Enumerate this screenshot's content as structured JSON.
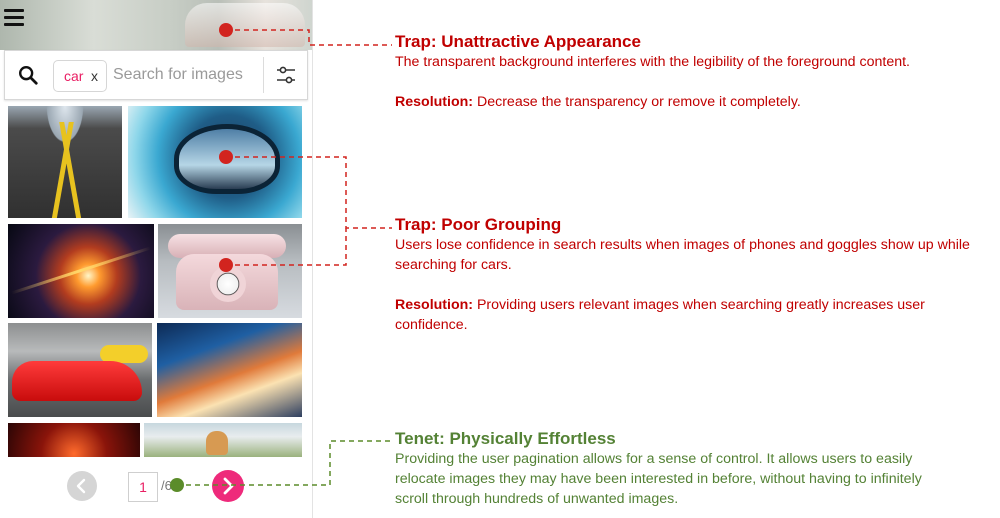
{
  "search": {
    "chip_label": "car",
    "chip_remove": "x",
    "placeholder": "Search for images"
  },
  "images": [
    {
      "subject": "road with yellow lines"
    },
    {
      "subject": "ski goggles reflection"
    },
    {
      "subject": "light streaks"
    },
    {
      "subject": "pink rotary telephone"
    },
    {
      "subject": "red Ferrari"
    },
    {
      "subject": "traffic light trails"
    },
    {
      "subject": "red light streaks"
    },
    {
      "subject": "dog on street"
    }
  ],
  "pagination": {
    "current_page": "1",
    "separator": "/6"
  },
  "colors": {
    "trap": "#c00000",
    "tenet": "#548235",
    "accent": "#ee2a7b",
    "marker_red": "#d2241f",
    "marker_green": "#5b8c2a"
  },
  "annotations": {
    "trap1": {
      "title": "Trap: Unattractive Appearance",
      "body": "The transparent background interferes with the legibility of the foreground content.",
      "resolution_label": "Resolution:",
      "resolution_text": " Decrease the transparency or remove it completely."
    },
    "trap2": {
      "title": "Trap: Poor Grouping",
      "body": "Users lose confidence in search results when images of phones and goggles show up while searching for cars.",
      "resolution_label": "Resolution:",
      "resolution_text": " Providing users relevant images when searching greatly increases user confidence."
    },
    "tenet": {
      "title": "Tenet: Physically Effortless",
      "body": "Providing the user pagination allows for a sense of control. It allows users to easily relocate images they may have been interested in before, without having to infinitely scroll through hundreds of unwanted images."
    }
  }
}
